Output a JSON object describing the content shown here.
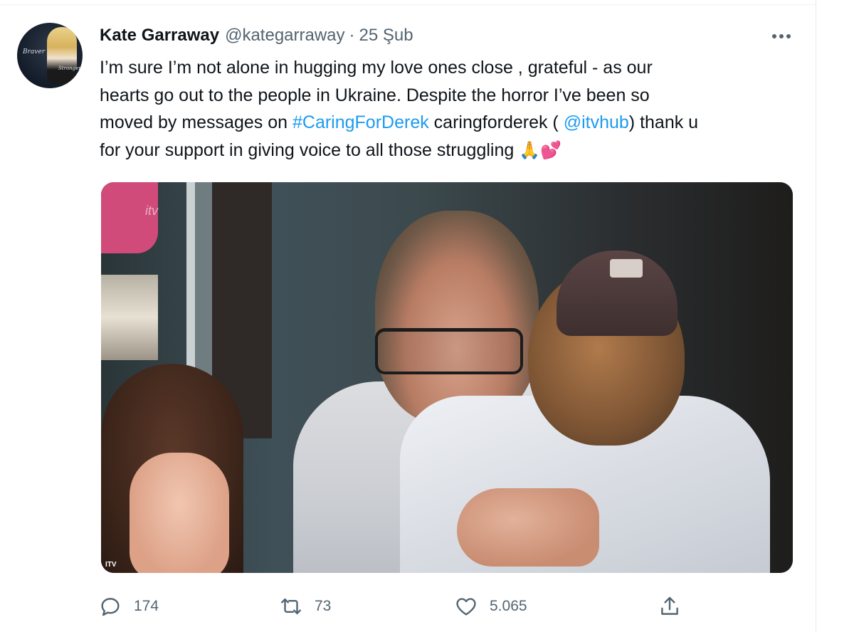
{
  "tweet": {
    "author": {
      "display_name": "Kate Garraway",
      "handle": "@kategarraway",
      "avatar_text_1": "Braver",
      "avatar_text_2": "Stronger"
    },
    "separator": "·",
    "date": "25 Şub",
    "more_icon": "more-horizontal-icon",
    "text": {
      "line1": "I’m sure I’m not alone in hugging my love ones close , grateful - as our",
      "line2": "hearts go out to the people in Ukraine. Despite the horror I’ve been so",
      "line3_pre": "moved by messages on ",
      "hashtag": "#CaringForDerek",
      "line3_mid": " caringforderek ( ",
      "mention": "@itvhub",
      "line3_post": ") thank u",
      "line4": "for your support in giving voice to all those struggling ",
      "emoji1": "🙏",
      "emoji2": "💕"
    },
    "media": {
      "watermark_top": "itv",
      "watermark_bottom": "ITV"
    },
    "actions": {
      "reply_count": "174",
      "retweet_count": "73",
      "like_count": "5.065"
    }
  },
  "colors": {
    "link": "#1d9bf0",
    "secondary_text": "#536471",
    "primary_text": "#0f1419"
  }
}
